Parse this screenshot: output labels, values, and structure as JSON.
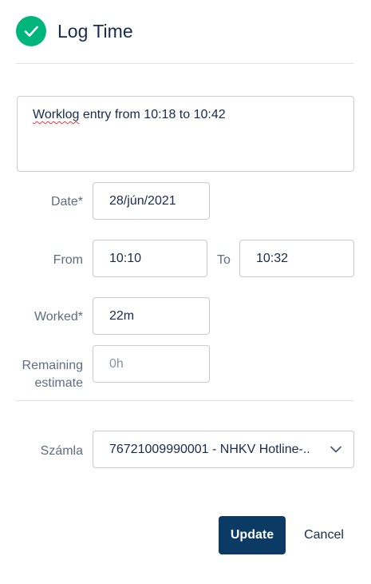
{
  "header": {
    "title": "Log Time",
    "icon": "check-circle-icon",
    "icon_color": "#00b57a"
  },
  "comment": {
    "prefix": "Worklog",
    "rest": " entry from 10:18 to 10:42"
  },
  "date": {
    "label": "Date*",
    "value": "28/jún/2021"
  },
  "time": {
    "from_label": "From",
    "from_value": "10:10",
    "to_label": "To",
    "to_value": "10:32"
  },
  "worked": {
    "label": "Worked*",
    "value": "22m"
  },
  "remaining": {
    "label_line1": "Remaining",
    "label_line2": "estimate",
    "placeholder": "0h"
  },
  "account": {
    "label": "Számla",
    "value": "76721009990001 - NHKV Hotline-..",
    "icon": "chevron-down-icon"
  },
  "actions": {
    "update_label": "Update",
    "cancel_label": "Cancel",
    "primary_color": "#0b3a65"
  }
}
